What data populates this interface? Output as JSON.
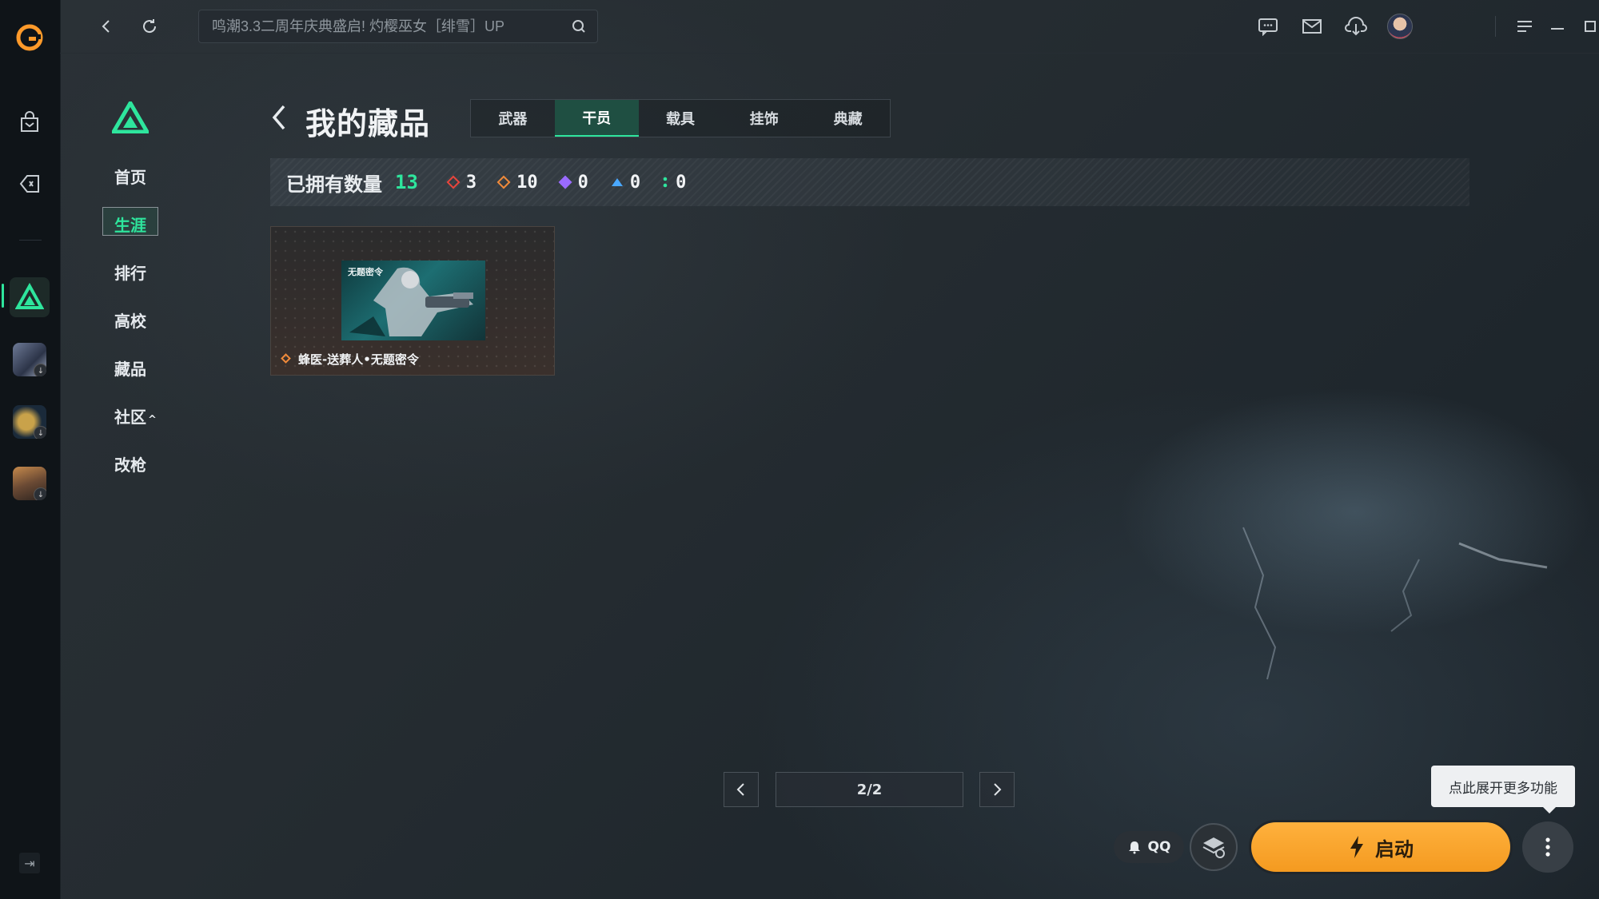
{
  "topbar": {
    "search_placeholder": "鸣潮3.3二周年庆典盛启! 灼樱巫女［绯雪］UP"
  },
  "sidebar": {
    "items": [
      {
        "label": "首页"
      },
      {
        "label": "生涯"
      },
      {
        "label": "排行"
      },
      {
        "label": "高校"
      },
      {
        "label": "藏品"
      },
      {
        "label": "社区"
      },
      {
        "label": "改枪"
      }
    ]
  },
  "header": {
    "title": "我的藏品",
    "tabs": [
      {
        "label": "武器"
      },
      {
        "label": "干员"
      },
      {
        "label": "载具"
      },
      {
        "label": "挂饰"
      },
      {
        "label": "典藏"
      }
    ],
    "active_tab": "干员"
  },
  "summary": {
    "owned_label": "已拥有数量",
    "owned_total": "13",
    "rarities": [
      {
        "color": "#e8453c",
        "count": "3"
      },
      {
        "color": "#f08a3a",
        "count": "10"
      },
      {
        "color": "#9a6bff",
        "count": "0"
      },
      {
        "color": "#4aa8ff",
        "count": "0"
      },
      {
        "color": "#2ee59d",
        "count": "0"
      }
    ]
  },
  "items": [
    {
      "name": "蜂医-送葬人•无题密令",
      "rarity_color": "#f08a3a",
      "image_caption": "无题密令"
    }
  ],
  "pagination": {
    "label": "2/2"
  },
  "actions": {
    "tooltip": "点此展开更多功能",
    "qq_label": "QQ",
    "launch_label": "启动"
  },
  "colors": {
    "accent": "#2ee59d",
    "launch": "#f7a52a"
  }
}
